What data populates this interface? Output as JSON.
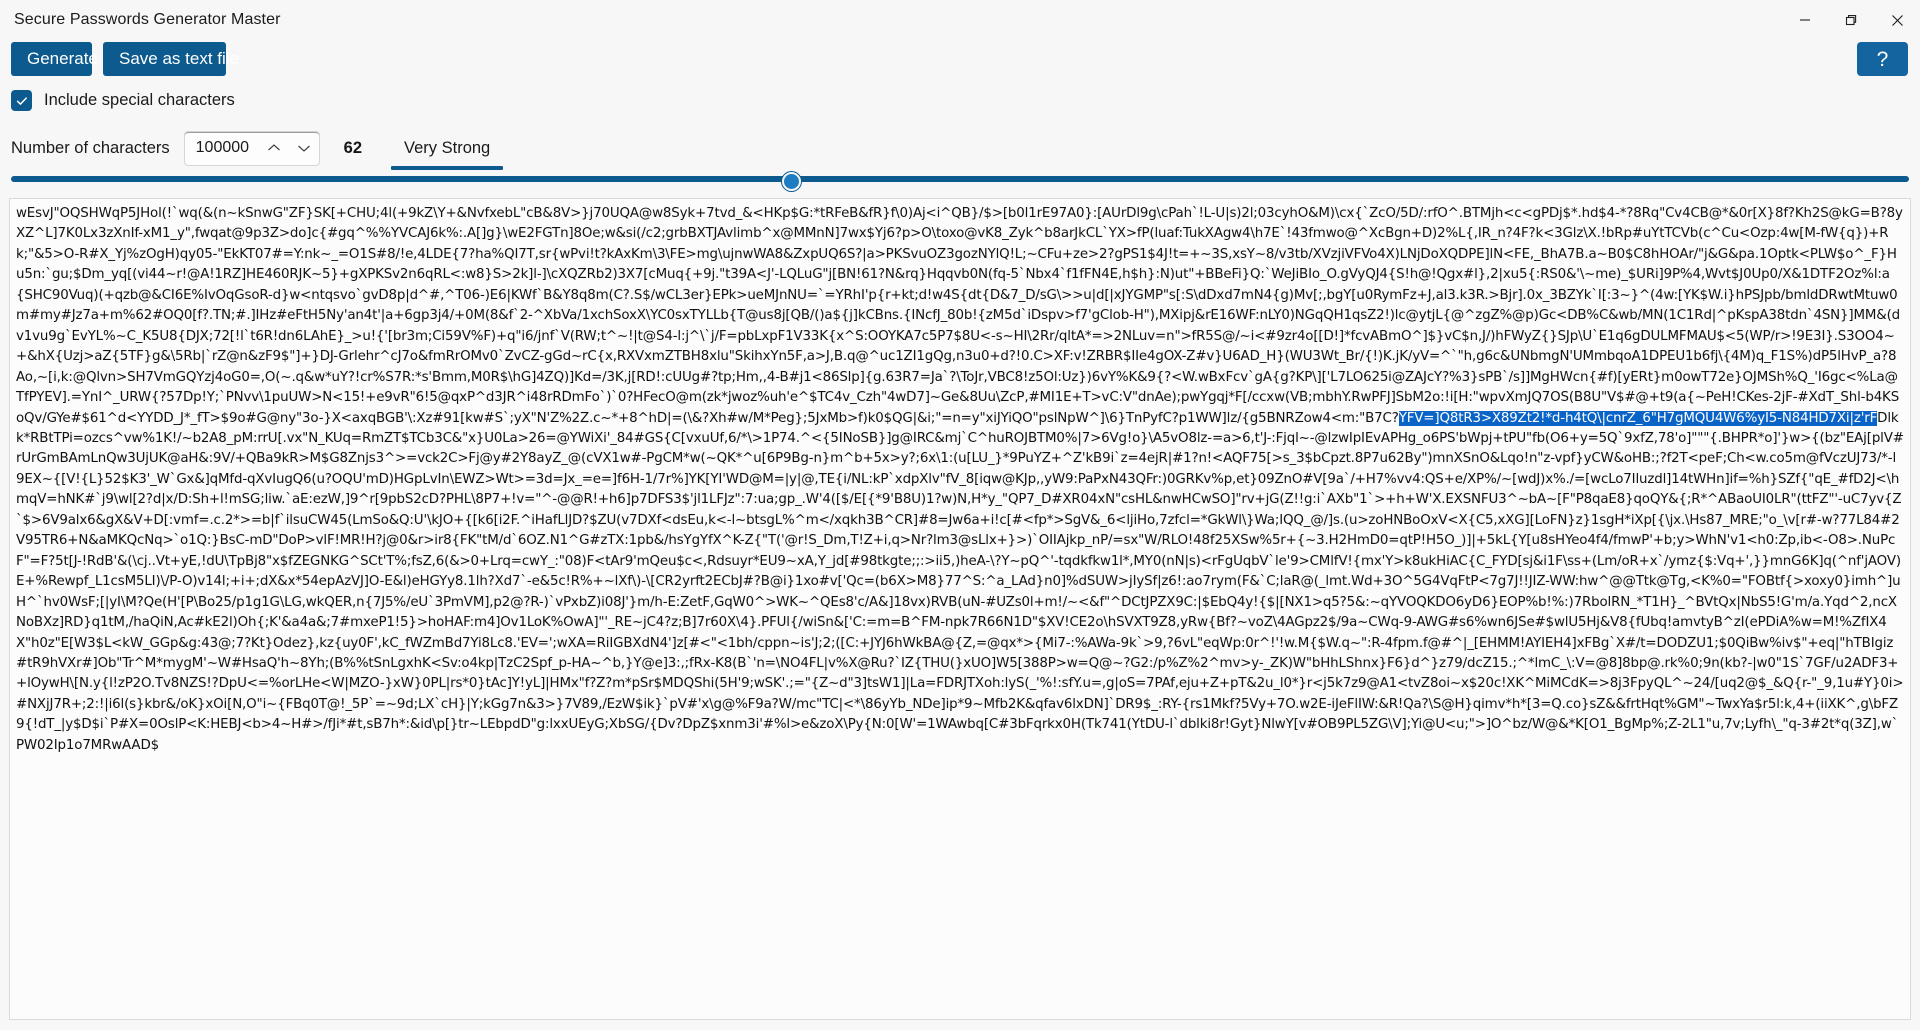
{
  "window": {
    "title": "Secure Passwords Generator Master",
    "controls": {
      "minimize": "minimize-icon",
      "maximize": "restore-icon",
      "close": "close-icon"
    }
  },
  "toolbar": {
    "generate_label": "Generate",
    "save_label": "Save as text file",
    "help_label": "?"
  },
  "options": {
    "special_chars_label": "Include special characters",
    "special_chars_checked": true,
    "check_icon": "check-icon"
  },
  "length": {
    "label": "Number of characters",
    "value": "100000",
    "up_icon": "chevron-up-icon",
    "down_icon": "chevron-down-icon"
  },
  "strength": {
    "count": "62",
    "text": "Very Strong",
    "bar_color": "#0c5a8e"
  },
  "slider": {
    "value_percent": 41,
    "track_color": "#0c5a8e",
    "thumb_color": "#1d7cc2"
  },
  "colors": {
    "accent": "#0c5a8e",
    "help_accent": "#1464a0",
    "selection": "#0a64c8",
    "window_bg": "#f7f7f7",
    "field_bg": "#fcfcfc"
  },
  "output": {
    "selection_text": "YFV=]Q8tR3>X89Zt2!*d-h4tQ\\|cnrZ_6\"H7gMQU4W6%yI5-N84HD7Xi|z'rF",
    "part1": "wEsvJ\"OQSHWqP5JHol(!`wq(&(n~kSnwG\"ZF}SK[+CHU;4l(+9kZ\\Y+&NvfxebL\"cB&8V>}j70UQA@w8Syk+7tvd_&<HKp$G:*tRFeB&fR}f\\0)Aj<i^QB}/$>[b0l1rE97A0}:[AUrDl9g\\cPah`!L-U|s)2l;03cyhO&M)\\cx{`ZcO/5D/:rfO^.BTMjh<c<gPDj$*.hd$4-*?8Rq\"Cv4CB@*&0r[X}8f?Kh2S@kG=B?8yXZ^L]7K0Lx3zXnIf-xM1_y\",fwqat@9p3Z>do]c{#gq^%%YVCAJ6k%:.A[]g}\\wE2FGTn]8Oe;w&si(/c2;grbBXTJAvlimb^x@MMnN]7wx$Yj6?p>O\\toxo@vK8_Zyk^b8arJkCL`YX>fP(luaf:TukXAgw4\\h7E`!43fmwo@^XcBgn+D)2%L{,IR_n?4F?k<3Glz\\X.!bRp#uYtTCVb(c^Cu<Ozp:4w[M-fW{q})+Rk;\"&5>O-R#X_Yj%zOgH)qy05-\"EkKT07#=Y:nk~_=O1S#8/!e,4LDE{7?ha%QI7T,sr{wPvi!t?kAxKm\\3\\FE>mg\\ujnwWA8&ZxpUQ6S?|a>PKSvuOZ3gozNYlQ!L;~CFu+ze>2?gPS1$4J!t=+~3S,xsY~8/v3tb/XVzjiVFVo4X)LNjDoXQDPE]lN<FE,_BhA7B.a~B0$C8hHOAr/\"j&G&pa.1Optk<PLW$o^_F}Hu5n:`gu;$Dm_yq[(vi44~r!@A!1RZ]HE460RJK~5}+gXPKSv2n6qRL<:w8}S>2k]l-]\\cXQZRb2)3X7[cMuq{+9j.\"t39A<J'-LQLuG\"j[BN!61?N&rq}Hqqvb0N(fq-5`Nbx4`f1fFN4E,h$h}:N)ut\"+BBeFi}Q:`WeJiBIo_O.gVyQJ4{S!h@!Qgx#l},2|xu5{:RS0&'\\~me)_$URi]9P%4,Wvt$J0Up0/X&1DTF2Oz%l:a{SHC90Vuq)(+qzb@&CI6E%IvOqGsoR-d}w<ntqsvo`gvD8p|d^#,^T06-)E6|KWf`B&Y8q8m(C?.S$/wCL3er}EPk>ueMJnNU=`=YRhI'p{r+kt;d!w4S{dt{D&7_D/sG\\>>u|d[|xJYGMP\"s[:S\\dDxd7mN4{g)Mv[;,bgY[u0RymFz+J,al3.k3R.>Bjr].0x_3BZYk`I[:3~}^(4w:[YK$W.i}hPSJpb/bmldDRwtMtuw0m#my#Jz7a+m%62#OQ0[f?.TN;#.]IHz#eFtH5Ny'an4t'|a+6gp3j4/+0M(8&f`2-^XbVa/1xchSoxX\\YC0sxTYLLb{T@us8j[QB/()a${j]kCBns.{INcfJ_80b!{zM5d`iDspv>f7'gClob-H\"),MXipj&rE16WF:nLY0)NGqQH1qsZ2!)lc@ytjL{@^zgZ%@p)Gc<DB%C&wb/MN(1C1Rd|^pKspA38tdn`4SN}]MM&(dv1vu9g`EvYL%~C_K5U8{DJX;72[!l`t6R!dn6LAhE}_>u!{'[br3m;Ci59V%F)+q\"i6/jnf`V(RW;t^~!|t@S4-l:j^\\`j/F=pbLxpF1V33K{x^S:OOYKA7c5P7$8U<-s~HI\\2Rr/qltA*=>2NLuv=n\">fR5S@/~i<#9zr4o[[D!]*fcvABmO^]$}vC$n,J/)hFWyZ{}SJp\\U`E1q6gDULMFMAU$<5(WP/r>!9E3I}.S3OO4~+&hX{Uzj>aZ{5TF}g&\\5Rb|`rZ@n&zF9$\"]+}DJ-Grlehr^cJ7o&fmRrOMv0`ZvCZ-gGd~rC{x,RXVxmZTBH8xlu\"SkihxYn5F,a>J,B.q@^uc1ZI1gQg,n3u0+d?!0.C>XF:v!ZRBR$IIe4gOX-Z#v}U6AD_H}(WU3Wt_Br/{!)K.jK/yV=^`\"h,g6c&UNbmgN'UMmbqoA1DPEU1b6fj\\{4M)q_F1S%)dP5lHvP_a?8Ao,~[i,k:@Qlvn>SH7VmGQYzj4oG0=,O(~.q&w*uY?!cr%S7R:*s'Bmm,M0R$\\hG]4ZQ)]Kd=/3K,j[RD!:cUUg#?tp;Hm,,4-B#j1<86Slp]{g.63R7=Ja`?\\ToJr,VBC8!z5Ol:Uz})6vY%K&9{?<W.wBxFcv`gA{g?KP\\]['L7LO625i@ZAJcY?%3}sPB`/s]]MgHWcn{#f)[yERt}m0owT72e}OJMSh%Q_'I6gc<%La@TfPYEV].=YnI^_URW{?57Dp!Y;`PNvv\\1puUW>N<15!+e9vR\"6!5@qxP^d3JR^i48rRDmFo`)`0?HFecO@m(zk*jwoz%uh'e^$TC4v_Czh\"4wD7]~Ge&8Uu\\ZcP,#MI1E+T>vC:V\"dnAe);pwYgqj*F[/ccxw(VB;mbhY.RwPFJ]SbM2o:!i[H:\"wpvXmJQ7OS(B8U\"V$#@+t9(a{~PeH!CKes-2jF-#XdT_Shl-b4KSoQv/GYe#$61^d<YYDD_J*_fT>$9o#G@ny\"3o-}X<axqBGB'\\:Xz#91[kw#S`;yX\"N'Z%2Z.c~*+8^hD|=(\\&?Xh#w/M*Peg};5JxMb>f)k0$QG|&i;\"=n=y\"xiJYiQO\"pslNpW^]\\6}TnPyfC?p1WW]lz/{g5BNRZow4<m:\"B7C?",
    "part2": "Dlkk*RBtTPi=ozcs^vw%1K!/~b2A8_pM:rrU[.vx\"N_KUq=RmZT$TCb3C&\"x}U0La>26=@YWiXi'_84#GS{C[vxuUf,6/*\\>1P74.^<{5INoSB}]g@IRC&mj`C^huROJBTM0%|7>6Vg!o}\\A5vO8lz-=a>6,t'J-:Fjql~-@lzwIpIEvAPHg_o6PS'bWpj+tPU\"fb(O6+y=5Q`9xfZ,78'o]\"\"\"{.BHPR*o]'}w>{(bz\"EAj[plV#rUrGmBAmLnQw3UjUK@aH&:9V/+QBa9kR>M$G8Znjs3^>=vck2C>Fj@y#2Y8ayZ_@(cVX1w#-PgCM*w(~QK*^u[6P9Bg-n}m^b+5x>y?;6x\\1:(u[LU_}*9PuYZ+^Z'kB9i`z=4ejR|#1?n!<AQF75[>s_3$bCpzt.8P7u62By\")mnXSnO&Lqo!n\"z-vpf}yCW&oHB:;?f2T<peF;Ch<w.co5m@fVczUJ73/*-l9EX~{[V!{L}52$K3'_W`Gx&]qMfd-qXvIugQ6(u?OQU'mD)HGpLvIn\\EWZ>Wt>=3d=Jx_=e=]f6H-1/7r%]YK[YI'WD@M=|y|@,TE{i/NL:kP`xdpXlv\"fV_8[iqw@KJp,,yW9:PaPxN43QFr:)0GRKv%p,et}09ZnO#V[9a`/+H7%vv4:QS+e/XP%/~[wdJ)x%./=[wcLo7Iluzdl]14tWHn]if=%h}SZf{\"qE_#fD2J<\\hmqV=hNK#`j9\\wl[2?d|x/D:Sh+l!mSG;liw.`aE:ezW,]9^r[9pbS2cD?PHL\\8P7+!v=\"^-@@R!+h6]p7DFS3$'jl1LFJz\":7:ua;gp_.W'4([$/E[{*9'B8U)1?w)N,H*y_\"QP7_D#XR04xN\"csHL&nwHCwSO]\"rv+jG(Z!!g:i`AXb\"1`>+h+W'X.EXSNFU3^~bA~[F\"P8qaE8}qoQY&{;R*^ABaoUI0LR\"(ttFZ\"'-uC7yv{Z`$>6V9alx6&gX&V+D[:vmf=.c.2*>=b|f`ilsuCW45(LmSo&Q:U'\\kJO+{[k6[i2F.^iHafLlJD?$ZU(v7DXf<dsEu,k<-l~btsgL%^m</xqkh3B^CR]#8=Jw6a+i!c[#<fp*>SgV&_6<ljiHo,7zfcl=*GkWl\\}Wa;IQQ_@/]s.(u>zoHNBoOxV<X{C5,xXG][LoFN}z}1sgH*iXp[{\\jx.\\Hs87_MRE;\"o_\\v[r#-w?77L84#2V95TR6+N&aMKQcNq>`o1Q:}BsC-mD\"DoP>vlF!MR!H?j@0&r>ir8{FK\"tM/d`6OZ.N1^G#zTX:1pb&/hsYgYfX^K-Z{\"T('@r!S_Dm,T!Z+i,q>Nr?lm3@sLlx+}>)`OIIAjkp_nP/=sx\"W/RLO!48f25XSw%5r+{~3.H2HmD0=qtP!H5O_)]|+5kL{Y[u8sHYeo4f4/fmwP'+b;y>WhN'v1<h0:Zp,ib<-O8>.NuPcF\"=F?5t[J-!RdB'&(\\cj..Vt+yE,!dU\\TpBj8\"x$fZEGNKG^SCt'T%;fsZ,6(&>0+Lrq=cwY_:\"08)F<tAr9'mQeu$c<,Rdsuyr*EU9~xA,Y_jd[#98tkgte;;:>ii5,)heA-\\?Y~pQ^'-tqdkfkw1l*,MY0(nN|s)<rFgUqbV`le'9>CMlfV!{mx'Y>k8ukHiAC{C_FYD[sj&i1F\\ss+(Lm/oR+x`/ymz{$:Vq+',}}mnG6K]q(^nf'jAOV)E+%Rewpf_L1csM5LI)\\/P-O)v14l;+i+;dX&x*54epAzVJ]O-E&l)eHGYy8.1lh?Xd7`-e&5c!R%+~lXf\\)-\\[CR2yrft2ECbJ#?B@i}1xo#v['Qc=(b6X>M8}77^S:^a_LAd}n0]%dSUW>jIySf|z6!:ao7rym(F&`C;laR@(_lmt.Wd+3O^5G4VqFtP<7g7J!!JIZ-WW:hw^@@Ttk@Tg,<K%0=\"FOBtf{>xoxy0}imh^]uH^`hv0WsF;[|yI\\M?Qe(H'[P\\Bo25/p1g1G\\LG,wkQER,n{7J5%/eU`3PmVM],p2@?R-)`vPxbZ)i08J'}m/h-E:ZetF,GqW0^>WK~^QEs8'c/A&]18vx)RVB(uN-#UZs0l+m!/~<&f\"^DCtJPZX9C:|$EbQ4y!{$|[NX1>q5?5&:~qYVOQKDO6yD6}EOP%b!%:)7RbolRN_*T1H}_^BVtQx|NbS5!G'm/a.Yqd^2,ncXNoBXz]RD}q1tM,/haQiN,Ac#kE2l)Oh{;K'&a4a&;7#mxeP1!5}>hoHAF:m4]Ov1LoK%OwA]\"'_RE~jC4?z;B]7r60X\\4}.PFUl{/wiSn&['C:=m=B^FM-npk7R66N1D\"$XV!CE2o\\hSVXT9Z8,yRw{Bf?~voZ\\4AGpz2$/9a~CWq-9-AWG#s6%wn6JSe#$wlU5Hj&V8{fUbq!amvtyB^zI(ePDiA%w=M!%ZfIX4X\"h0z\"E[W3$L<kW_GGp&g:43@;7?Kt}Odez},kz{uy0F',kC_fWZmBd7Yi8Lc8.'EV=';wXA=RiIGBXdN4']z[#<\"<1bh/cppn~is'J;2;([C:+JYJ6hWkBA@{Z,=@qx*>{Mi7-:%AWa-9k`>9,?6vL\"eqWp:0r^!'!w.M{$W.q~\":R-4fpm.f@#^|_[EHMM!AYIEH4]xFBg`X#/t=DODZU1;$0QiBw%iv$\"+eq|\"hTBIgiz#tR9hVXr#]Ob\"Tr^M*mygM'~W#HsaQ'h~8Yh;(B%%tSnLgxhK<Sv:o4kp|TzC2Spf_p-HA~^b,}Y@e]3:,;fRx-K8(B`'n=\\NO4FL|v%X@Ru?`IZ{THU(}xUO]W5[388P>w=Q@~?G2:/p%Z%2^mv>y-_ZK)W\"bHhLShnx}F6}d^}z79/dcZ15.;^*lmC_\\:V=@8]8bp@.rk%0;9n(kb?-|w0\"1S`7GF/u2ADF3++lOywH\\[N.y{l!zP2O.Tv8NZS!?DpU<=%orLHe<W|MZO-}xW}0PL|rs*0}tAc]Y!yL]|HMx\"f?Z?m*pSr$MDQShi(5H'9;wSK'.;=\"{Z~d\"3]tsW1]|La=FDRJTXoh:lyS(_'%!:sfY.u=,g|oS=7PAf,eju+Z+pT&2u_l0*}r<j5k7z9@A1<tvZ8oi~x$20c!XK^MiMCdK=>8j3FpyQL^~24/[uq2@$_&Q{r-\"_9,1u#Y}0i>#NXjJ7R+;2:!|i6l(s}kbr&/oK}xOi[N,O\"i~{FBq0T@!_5P`=~9d;LX`cH}|Y;kGg7n&3>}7V89,/EzW$ik}`pV#'x\\g@%F9a?W/mc\"TC|<*\\86yYb_NDe]ip*9~Mfb2K&qfav6lxDN]`DR9$_:RY-{rs1Mkf?5Vy+7O.w2E-iJeFlIW:&R!Qa?\\S@H}qimv*h*[3=Q.co}sZ&&frtHqt%GM\"~TwxYa$r5l:k,4+(iiXK^,g\\bFZ9{!dT_|y$D$i`P#X=0OslP<K:HEBJ<b>4~H#>/fJi*#t,sB7h*:&id\\p[}tr~LEbpdD\"g:lxxUEyG;XbSG/{Dv?DpZ$xnm3i'#%l>e&zoX\\Py{N:0[W'=1WAwbq[C#3bFqrkx0H(Tk741(YtDU-l`dblki8r!Gyt}NlwY[v#OB9PL5ZG\\V];Yi@U<u;\">]O^bz/W@&*K[O1_BgMp%;Z-2L1\"u,7v;Lyfh\\_\"q-3#2t*q(3Z],w`PW02Ip1o7MRwAAD$"
  }
}
